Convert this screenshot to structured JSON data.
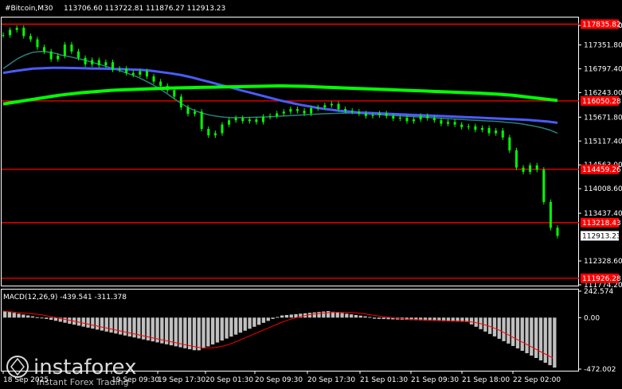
{
  "header": {
    "symbol": "#Bitcoin,M30",
    "ohlc": "113706.60 113722.81 111876.27 112913.23"
  },
  "colors": {
    "background": "#000000",
    "frame": "#ffffff",
    "candle": "#00ff00",
    "ma_fast": "#2a7f7f",
    "ma_mid": "#4a5cff",
    "ma_slow": "#00ff00",
    "level": "#ff0000",
    "osc_hist": "#c0c0c0",
    "osc_signal": "#ff0000"
  },
  "price_labels": [
    {
      "text": "117806.20",
      "value": 117806.2
    },
    {
      "text": "117351.80",
      "value": 117351.8
    },
    {
      "text": "116797.40",
      "value": 116797.4
    },
    {
      "text": "116243.00",
      "value": 116243.0
    },
    {
      "text": "115671.80",
      "value": 115671.8
    },
    {
      "text": "115117.40",
      "value": 115117.4
    },
    {
      "text": "114563.00",
      "value": 114563.0
    },
    {
      "text": "114008.60",
      "value": 114008.6
    },
    {
      "text": "113437.40",
      "value": 113437.4
    },
    {
      "text": "112328.60",
      "value": 112328.6
    },
    {
      "text": "111774.20",
      "value": 111774.2
    }
  ],
  "current_price": {
    "text": "112913.23",
    "value": 112913.23
  },
  "levels": [
    {
      "text": "117835.82",
      "value": 117835.82
    },
    {
      "text": "116050.28",
      "value": 116050.28
    },
    {
      "text": "114459.26",
      "value": 114459.26
    },
    {
      "text": "113218.43",
      "value": 113218.43
    },
    {
      "text": "111926.28",
      "value": 111926.28
    }
  ],
  "oscillator": {
    "label": "MACD(12,26,9) -439.541 -311.378",
    "levels": [
      {
        "text": "242.574",
        "value": 242.574
      },
      {
        "text": "0.00",
        "value": 0
      },
      {
        "text": "-472.002",
        "value": -472.002
      }
    ]
  },
  "time_labels": [
    "18 Sep 2025",
    "19 Sep 09:30",
    "19 Sep 17:30",
    "20 Sep 01:30",
    "20 Sep 09:30",
    "20 Sep 17:30",
    "21 Sep 01:30",
    "21 Sep 09:30",
    "21 Sep 18:00",
    "22 Sep 02:00"
  ],
  "watermark": {
    "brand": "instaforex",
    "tagline": "Instant Forex Trading"
  },
  "chart_data": {
    "type": "line",
    "title": "#Bitcoin,M30",
    "y_range": [
      111774.2,
      117990
    ],
    "series": [
      {
        "key": "price",
        "values": [
          117580,
          117700,
          117750,
          117560,
          117480,
          117300,
          117200,
          117020,
          117100,
          117360,
          117200,
          117050,
          116900,
          117000,
          116880,
          116950,
          116780,
          116800,
          116700,
          116660,
          116740,
          116620,
          116500,
          116400,
          116300,
          116150,
          115900,
          115750,
          115800,
          115400,
          115250,
          115300,
          115500,
          115600,
          115650,
          115580,
          115620,
          115560,
          115680,
          115700,
          115760,
          115800,
          115860,
          115820,
          115760,
          115880,
          115900,
          115950,
          115980,
          115860,
          115820,
          115800,
          115760,
          115700,
          115720,
          115760,
          115700,
          115640,
          115660,
          115580,
          115620,
          115700,
          115650,
          115600,
          115520,
          115560,
          115500,
          115440,
          115460,
          115380,
          115420,
          115300,
          115360,
          115200,
          114900,
          114500,
          114400,
          114550,
          114450,
          113700,
          113100,
          112913
        ]
      },
      {
        "key": "ma_fast",
        "values": [
          116800,
          116920,
          117040,
          117120,
          117180,
          117200,
          117190,
          117160,
          117110,
          117080,
          117040,
          117000,
          116950,
          116900,
          116850,
          116800,
          116740,
          116680,
          116620,
          116540,
          116450,
          116350,
          116240,
          116120,
          116000,
          115900,
          115820,
          115760,
          115720,
          115690,
          115670,
          115660,
          115660,
          115665,
          115670,
          115675,
          115680,
          115690,
          115700,
          115710,
          115720,
          115730,
          115740,
          115750,
          115755,
          115760,
          115765,
          115770,
          115760,
          115750,
          115740,
          115730,
          115720,
          115710,
          115700,
          115690,
          115680,
          115670,
          115660,
          115650,
          115640,
          115630,
          115620,
          115610,
          115600,
          115590,
          115580,
          115570,
          115555,
          115540,
          115520,
          115490,
          115460,
          115420,
          115370,
          115300
        ]
      },
      {
        "key": "ma_mid",
        "values": [
          116700,
          116740,
          116770,
          116800,
          116810,
          116820,
          116820,
          116815,
          116810,
          116805,
          116800,
          116795,
          116790,
          116780,
          116770,
          116750,
          116720,
          116690,
          116650,
          116600,
          116540,
          116480,
          116420,
          116360,
          116300,
          116240,
          116180,
          116120,
          116060,
          116010,
          115960,
          115920,
          115880,
          115850,
          115820,
          115800,
          115780,
          115770,
          115760,
          115750,
          115740,
          115730,
          115720,
          115710,
          115700,
          115690,
          115680,
          115670,
          115660,
          115650,
          115640,
          115630,
          115620,
          115610,
          115590,
          115570,
          115540
        ]
      },
      {
        "key": "ma_slow",
        "values": [
          115980,
          116020,
          116060,
          116100,
          116140,
          116180,
          116210,
          116240,
          116260,
          116280,
          116300,
          116310,
          116320,
          116330,
          116340,
          116350,
          116355,
          116360,
          116365,
          116370,
          116375,
          116380,
          116385,
          116390,
          116395,
          116400,
          116395,
          116390,
          116380,
          116370,
          116360,
          116350,
          116340,
          116330,
          116320,
          116310,
          116300,
          116290,
          116280,
          116270,
          116260,
          116250,
          116240,
          116230,
          116215,
          116200,
          116180,
          116150,
          116120,
          116090,
          116060
        ]
      }
    ]
  }
}
